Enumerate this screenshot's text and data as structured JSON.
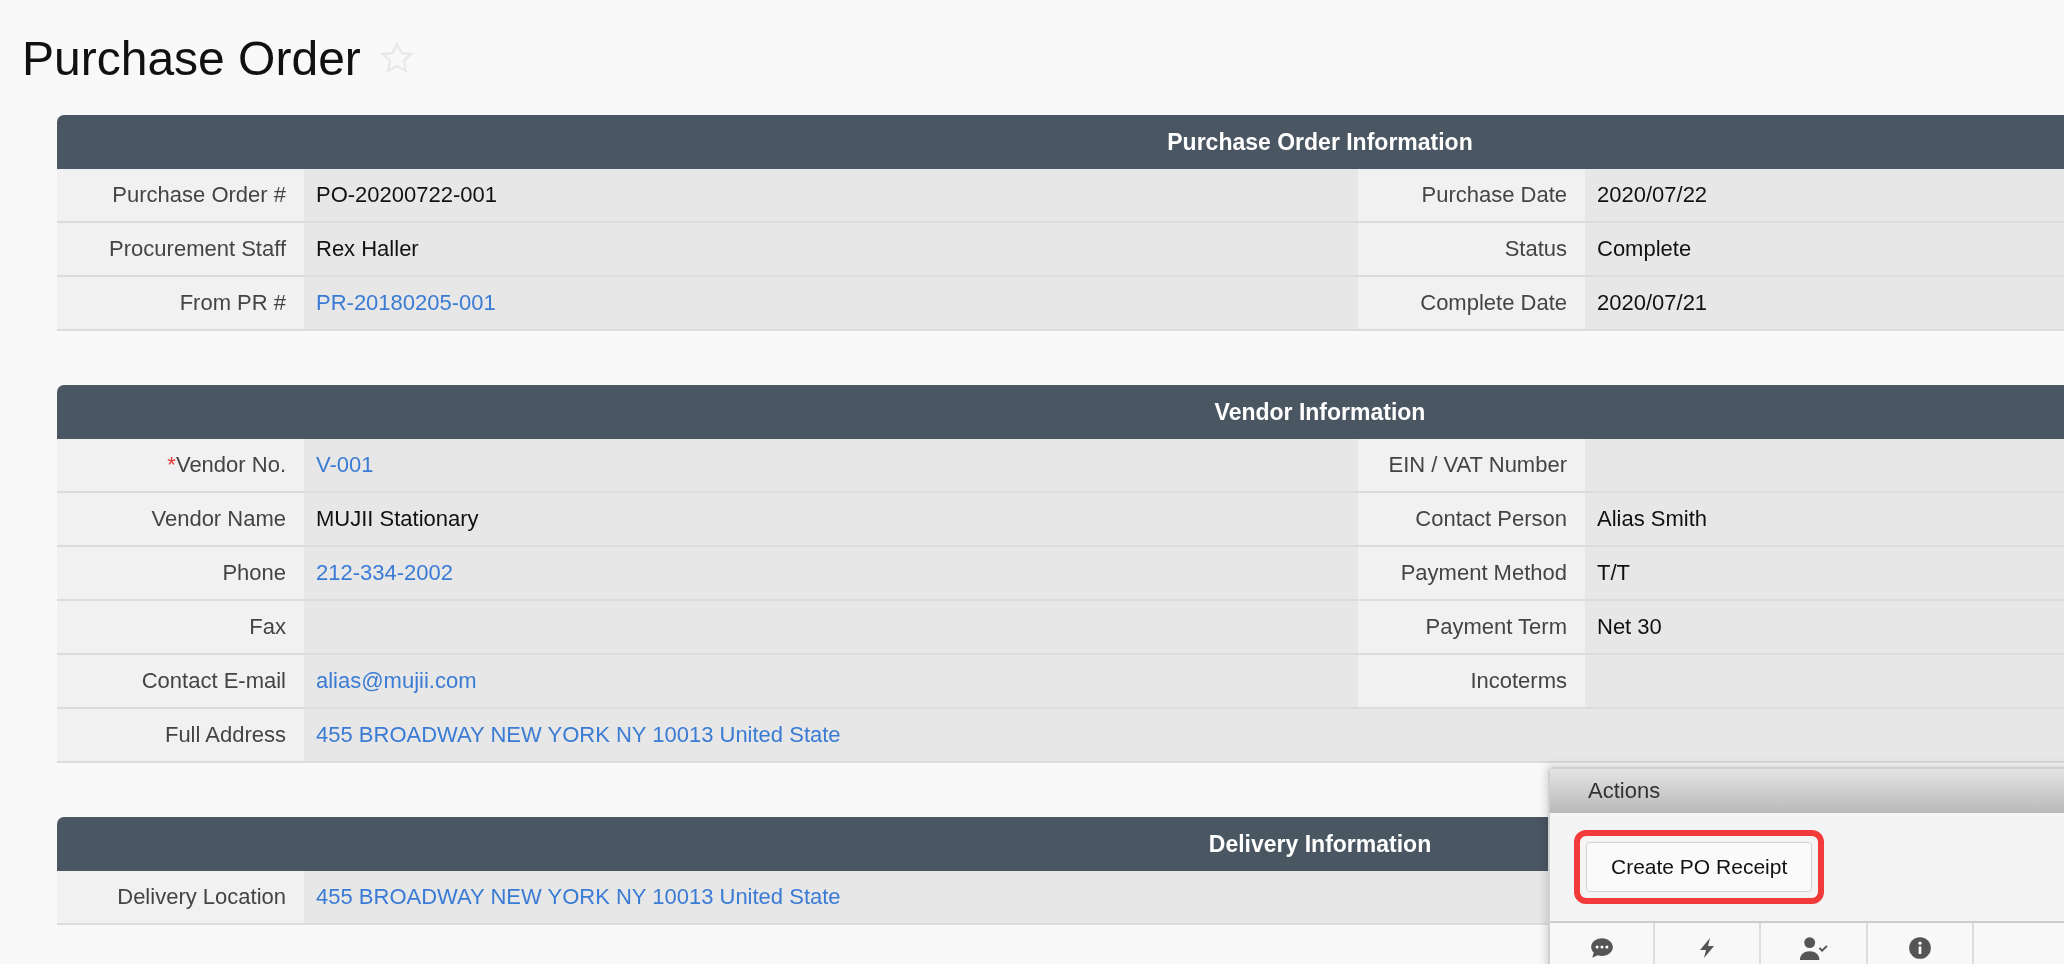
{
  "page": {
    "title": "Purchase Order",
    "favorite": false
  },
  "sections": [
    {
      "title": "Purchase Order Information",
      "rows": [
        {
          "fields": [
            {
              "label": "Purchase Order #",
              "value": "PO-20200722-001",
              "link": false
            },
            {
              "label": "Purchase Date",
              "value": "2020/07/22",
              "link": false
            }
          ]
        },
        {
          "fields": [
            {
              "label": "Procurement Staff",
              "value": "Rex Haller",
              "link": false
            },
            {
              "label": "Status",
              "value": "Complete",
              "link": false
            }
          ]
        },
        {
          "fields": [
            {
              "label": "From PR #",
              "value": "PR-20180205-001",
              "link": true
            },
            {
              "label": "Complete Date",
              "value": "2020/07/21",
              "link": false
            }
          ]
        }
      ]
    },
    {
      "title": "Vendor Information",
      "rows": [
        {
          "fields": [
            {
              "label": "Vendor No.",
              "marker": "*",
              "value": "V-001",
              "link": true
            },
            {
              "label": "EIN / VAT Number"
            }
          ]
        },
        {
          "fields": [
            {
              "label": "Vendor Name",
              "value": "MUJII Stationary",
              "link": false
            },
            {
              "label": "Contact Person",
              "value": "Alias Smith",
              "link": false
            }
          ]
        },
        {
          "fields": [
            {
              "label": "Phone",
              "value": "212-334-2002",
              "link": true
            },
            {
              "label": "Payment Method",
              "value": "T/T",
              "link": false
            }
          ]
        },
        {
          "fields": [
            {
              "label": "Fax"
            },
            {
              "label": "Payment Term",
              "value": "Net 30",
              "link": false
            }
          ]
        },
        {
          "fields": [
            {
              "label": "Contact E-mail",
              "value": "alias@mujii.com",
              "link": true
            },
            {
              "label": "Incoterms"
            }
          ]
        },
        {
          "fields": [
            {
              "label": "Full Address",
              "value": "455 BROADWAY NEW YORK NY 10013 United State",
              "link": true
            }
          ]
        }
      ]
    },
    {
      "title": "Delivery Information",
      "rows": [
        {
          "fields": [
            {
              "label": "Delivery Location",
              "value": "455 BROADWAY NEW YORK NY 10013 United State",
              "link": true
            }
          ]
        }
      ]
    }
  ],
  "actions": {
    "title": "Actions",
    "buttons": [
      {
        "label": "Create PO Receipt",
        "highlighted": true
      }
    ]
  }
}
